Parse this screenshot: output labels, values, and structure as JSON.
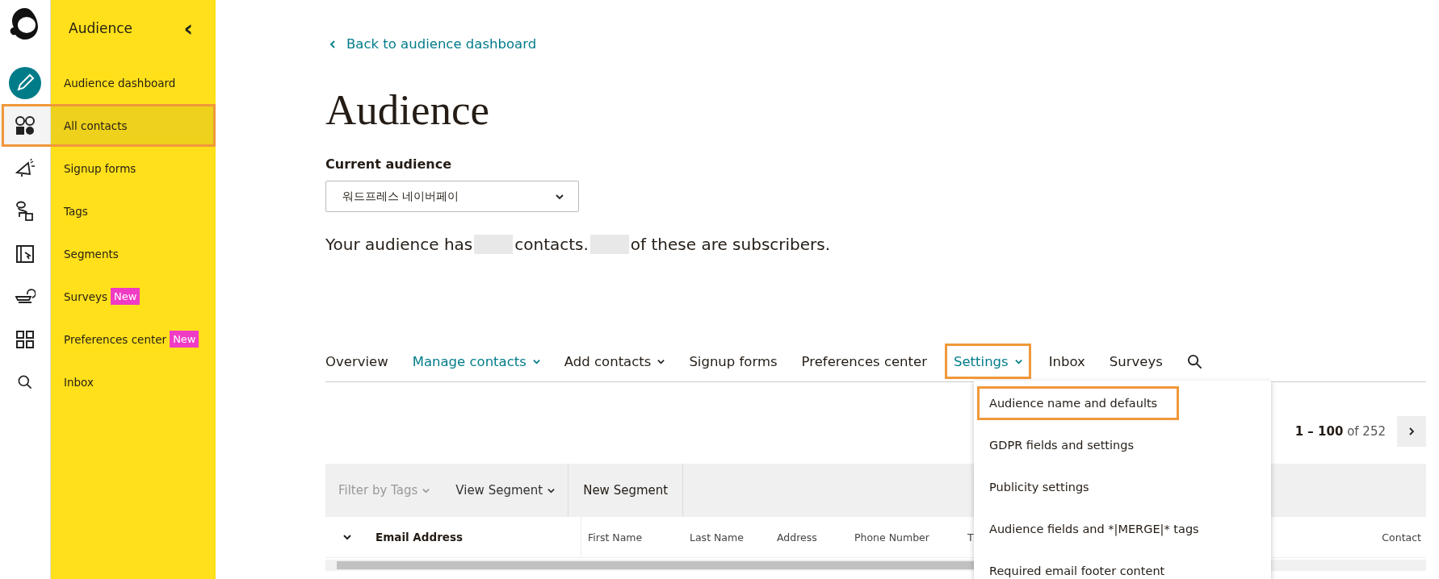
{
  "sidebar": {
    "title": "Audience",
    "collapse_glyph": "‹",
    "items": [
      {
        "label": "Audience dashboard",
        "selected": false,
        "highlighted": false
      },
      {
        "label": "All contacts",
        "selected": true,
        "highlighted": true
      },
      {
        "label": "Signup forms",
        "selected": false,
        "highlighted": false
      },
      {
        "label": "Tags",
        "selected": false,
        "highlighted": false
      },
      {
        "label": "Segments",
        "selected": false,
        "highlighted": false
      },
      {
        "label": "Surveys",
        "badge": "New",
        "selected": false,
        "highlighted": false
      },
      {
        "label": "Preferences center",
        "badge": "New",
        "selected": false,
        "highlighted": false
      },
      {
        "label": "Inbox",
        "selected": false,
        "highlighted": false
      }
    ]
  },
  "back_link": "Back to audience dashboard",
  "title": "Audience",
  "current_audience": {
    "label": "Current audience",
    "value": "워드프레스 네이버페이"
  },
  "summary": [
    "Your audience has",
    "contacts.",
    "of these are subscribers."
  ],
  "tabs": [
    {
      "label": "Overview",
      "kind": "plain",
      "selected": false,
      "open": false
    },
    {
      "label": "Manage contacts",
      "kind": "menu",
      "selected": true,
      "open": false
    },
    {
      "label": "Add contacts",
      "kind": "menu",
      "selected": false,
      "open": false
    },
    {
      "label": "Signup forms",
      "kind": "plain",
      "selected": false,
      "open": false
    },
    {
      "label": "Preferences center",
      "kind": "plain",
      "selected": false,
      "open": false
    },
    {
      "label": "Settings",
      "kind": "menu",
      "selected": true,
      "open": true
    },
    {
      "label": "Inbox",
      "kind": "plain",
      "selected": false,
      "open": false
    },
    {
      "label": "Surveys",
      "kind": "plain",
      "selected": false,
      "open": false
    },
    {
      "kind": "search",
      "selected": false,
      "open": false
    }
  ],
  "settings_menu": [
    {
      "label": "Audience name and defaults",
      "highlighted": true
    },
    {
      "label": "GDPR fields and settings",
      "highlighted": false
    },
    {
      "label": "Publicity settings",
      "highlighted": false
    },
    {
      "label": "Audience fields and *|MERGE|* tags",
      "highlighted": false
    },
    {
      "label": "Required email footer content",
      "highlighted": false
    }
  ],
  "pagination": "**1 – 100** of 252",
  "toolbar": [
    {
      "label": "Filter by Tags",
      "kind": "menu",
      "disabled": true
    },
    {
      "label": "View Segment",
      "kind": "menu",
      "disabled": false
    },
    {
      "label": "New Segment",
      "kind": "button",
      "disabled": false
    }
  ],
  "table": {
    "columns": [
      {
        "label": "Email Address",
        "kind": "primary"
      },
      {
        "label": "First Name",
        "kind": "normal"
      },
      {
        "label": "Last Name",
        "kind": "normal"
      },
      {
        "label": "Address",
        "kind": "normal"
      },
      {
        "label": "Phone Number",
        "kind": "normal"
      },
      {
        "label": "T",
        "kind": "normal"
      },
      {
        "label": "Contact",
        "kind": "end"
      }
    ]
  }
}
